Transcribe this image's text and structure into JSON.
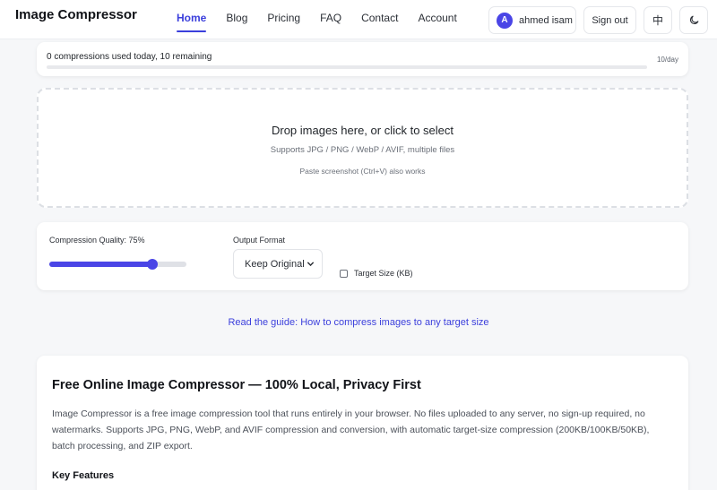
{
  "header": {
    "brand": "Image Compressor",
    "nav": [
      "Home",
      "Blog",
      "Pricing",
      "FAQ",
      "Contact",
      "Account"
    ],
    "active_nav": "Home",
    "user": {
      "initial": "A",
      "name": "ahmed isam"
    },
    "sign_out": "Sign out",
    "language_label": "中",
    "theme_icon": "moon-icon"
  },
  "usage": {
    "text": "0 compressions used today, 10 remaining",
    "limit": "10/day",
    "used_fraction": 0
  },
  "dropzone": {
    "title": "Drop images here, or click to select",
    "formats": "Supports JPG / PNG / WebP / AVIF, multiple files",
    "paste_hint": "Paste screenshot (Ctrl+V) also works"
  },
  "settings": {
    "quality_label": "Compression Quality: 75%",
    "quality_value": 75,
    "format_label": "Output Format",
    "format_selected": "Keep Original",
    "target_size_label": "Target Size (KB)",
    "target_size_checked": false
  },
  "guide_link": "Read the guide: How to compress images to any target size",
  "info": {
    "title": "Free Online Image Compressor — 100% Local, Privacy First",
    "body": "Image Compressor is a free image compression tool that runs entirely in your browser. No files uploaded to any server, no sign-up required, no watermarks. Supports JPG, PNG, WebP, and AVIF compression and conversion, with automatic target-size compression (200KB/100KB/50KB), batch processing, and ZIP export.",
    "features_heading": "Key Features"
  },
  "colors": {
    "accent": "#4a45e6",
    "link": "#3b3fdc",
    "background": "#f6f7f9"
  }
}
